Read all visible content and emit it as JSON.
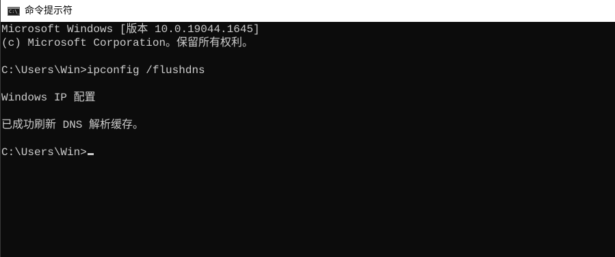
{
  "window": {
    "title": "命令提示符",
    "icon": "console-icon",
    "icon_glyph": "C:\\_"
  },
  "console": {
    "lines": [
      "Microsoft Windows [版本 10.0.19044.1645]",
      "(c) Microsoft Corporation。保留所有权利。",
      "",
      "C:\\Users\\Win>ipconfig /flushdns",
      "",
      "Windows IP 配置",
      "",
      "已成功刷新 DNS 解析缓存。",
      "",
      "C:\\Users\\Win>"
    ]
  },
  "colors": {
    "background": "#0c0c0c",
    "text": "#cccccc",
    "titlebar": "#ffffff"
  }
}
